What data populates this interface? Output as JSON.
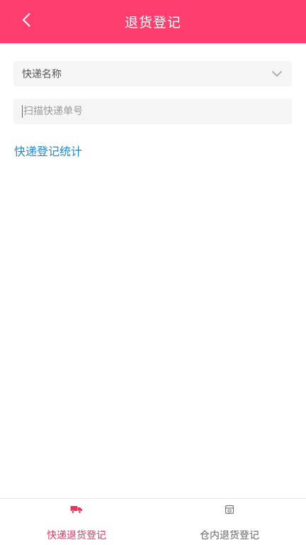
{
  "header": {
    "title": "退货登记",
    "back_icon": "chevron-left-icon",
    "background": "#ff3d6f"
  },
  "form": {
    "courier_select": {
      "value": "快递名称",
      "icon": "chevron-down-icon"
    },
    "scan_input": {
      "value": "",
      "placeholder": "扫描快递单号"
    },
    "stats_link": "快递登记统计"
  },
  "tabbar": {
    "active_color": "#e8345f",
    "tabs": [
      {
        "label": "快递退货登记",
        "icon": "truck-icon",
        "active": true
      },
      {
        "label": "仓内退货登记",
        "icon": "warehouse-icon",
        "active": false
      }
    ]
  },
  "colors": {
    "accent": "#ff3d6f",
    "link": "#1e88d8"
  }
}
